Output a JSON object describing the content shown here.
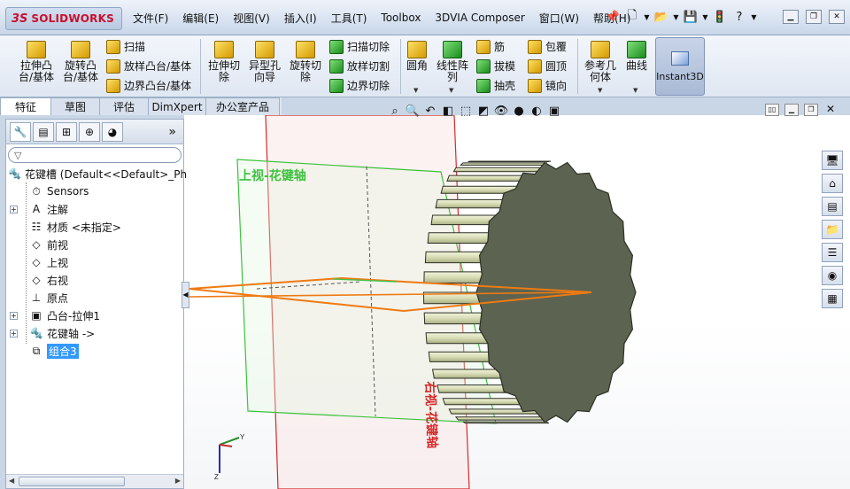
{
  "app": {
    "logo_ds": "3S",
    "logo_name": "SOLIDWORKS"
  },
  "menu": [
    "文件(F)",
    "编辑(E)",
    "视图(V)",
    "插入(I)",
    "工具(T)",
    "Toolbox",
    "3DVIA Composer",
    "窗口(W)",
    "帮助(H)"
  ],
  "ribbon": {
    "extrude_boss": "拉伸凸\n台/基体",
    "revolve_boss": "旋转凸\n台/基体",
    "sweep": "扫描",
    "loft_boss": "放样凸台/基体",
    "boundary_boss": "边界凸台/基体",
    "extrude_cut": "拉伸切\n除",
    "hole_wizard": "异型孔\n向导",
    "revolve_cut": "旋转切\n除",
    "sweep_cut": "扫描切除",
    "loft_cut": "放样切割",
    "boundary_cut": "边界切除",
    "fillet": "圆角",
    "linear_pattern": "线性阵\n列",
    "rib": "筋",
    "draft": "拔模",
    "shell": "抽壳",
    "wrap": "包覆",
    "dome": "圆顶",
    "mirror": "镜向",
    "ref_geometry": "参考几\n何体",
    "curves": "曲线",
    "instant3d": "Instant3D"
  },
  "tabs": [
    "特征",
    "草图",
    "评估",
    "DimXpert",
    "办公室产品"
  ],
  "active_tab": "特征",
  "feature_tree": {
    "root": "花键槽  (Default<<Default>_Ph",
    "items": [
      {
        "label": "Sensors",
        "icon": "sensors-icon",
        "expander": false
      },
      {
        "label": "注解",
        "icon": "annotations-icon",
        "expander": true
      },
      {
        "label": "材质 <未指定>",
        "icon": "material-icon",
        "expander": false
      },
      {
        "label": "前视",
        "icon": "plane-icon",
        "expander": false
      },
      {
        "label": "上视",
        "icon": "plane-icon",
        "expander": false
      },
      {
        "label": "右视",
        "icon": "plane-icon",
        "expander": false
      },
      {
        "label": "原点",
        "icon": "origin-icon",
        "expander": false
      },
      {
        "label": "凸台-拉伸1",
        "icon": "extrude-icon",
        "expander": true
      },
      {
        "label": "花键轴 ->",
        "icon": "part-icon",
        "expander": true
      },
      {
        "label": "组合3",
        "icon": "combine-icon",
        "expander": false,
        "selected": true
      }
    ]
  },
  "viewport": {
    "top_plane_label": "上视-花键轴",
    "right_plane_label": "右视-花键轴"
  },
  "colors": {
    "spline_body": "#d8dcb4",
    "end_face": "#5c6350",
    "right_plane": "#d62a2a",
    "top_plane": "#3cc23c",
    "sketch": "#ef7a12"
  }
}
